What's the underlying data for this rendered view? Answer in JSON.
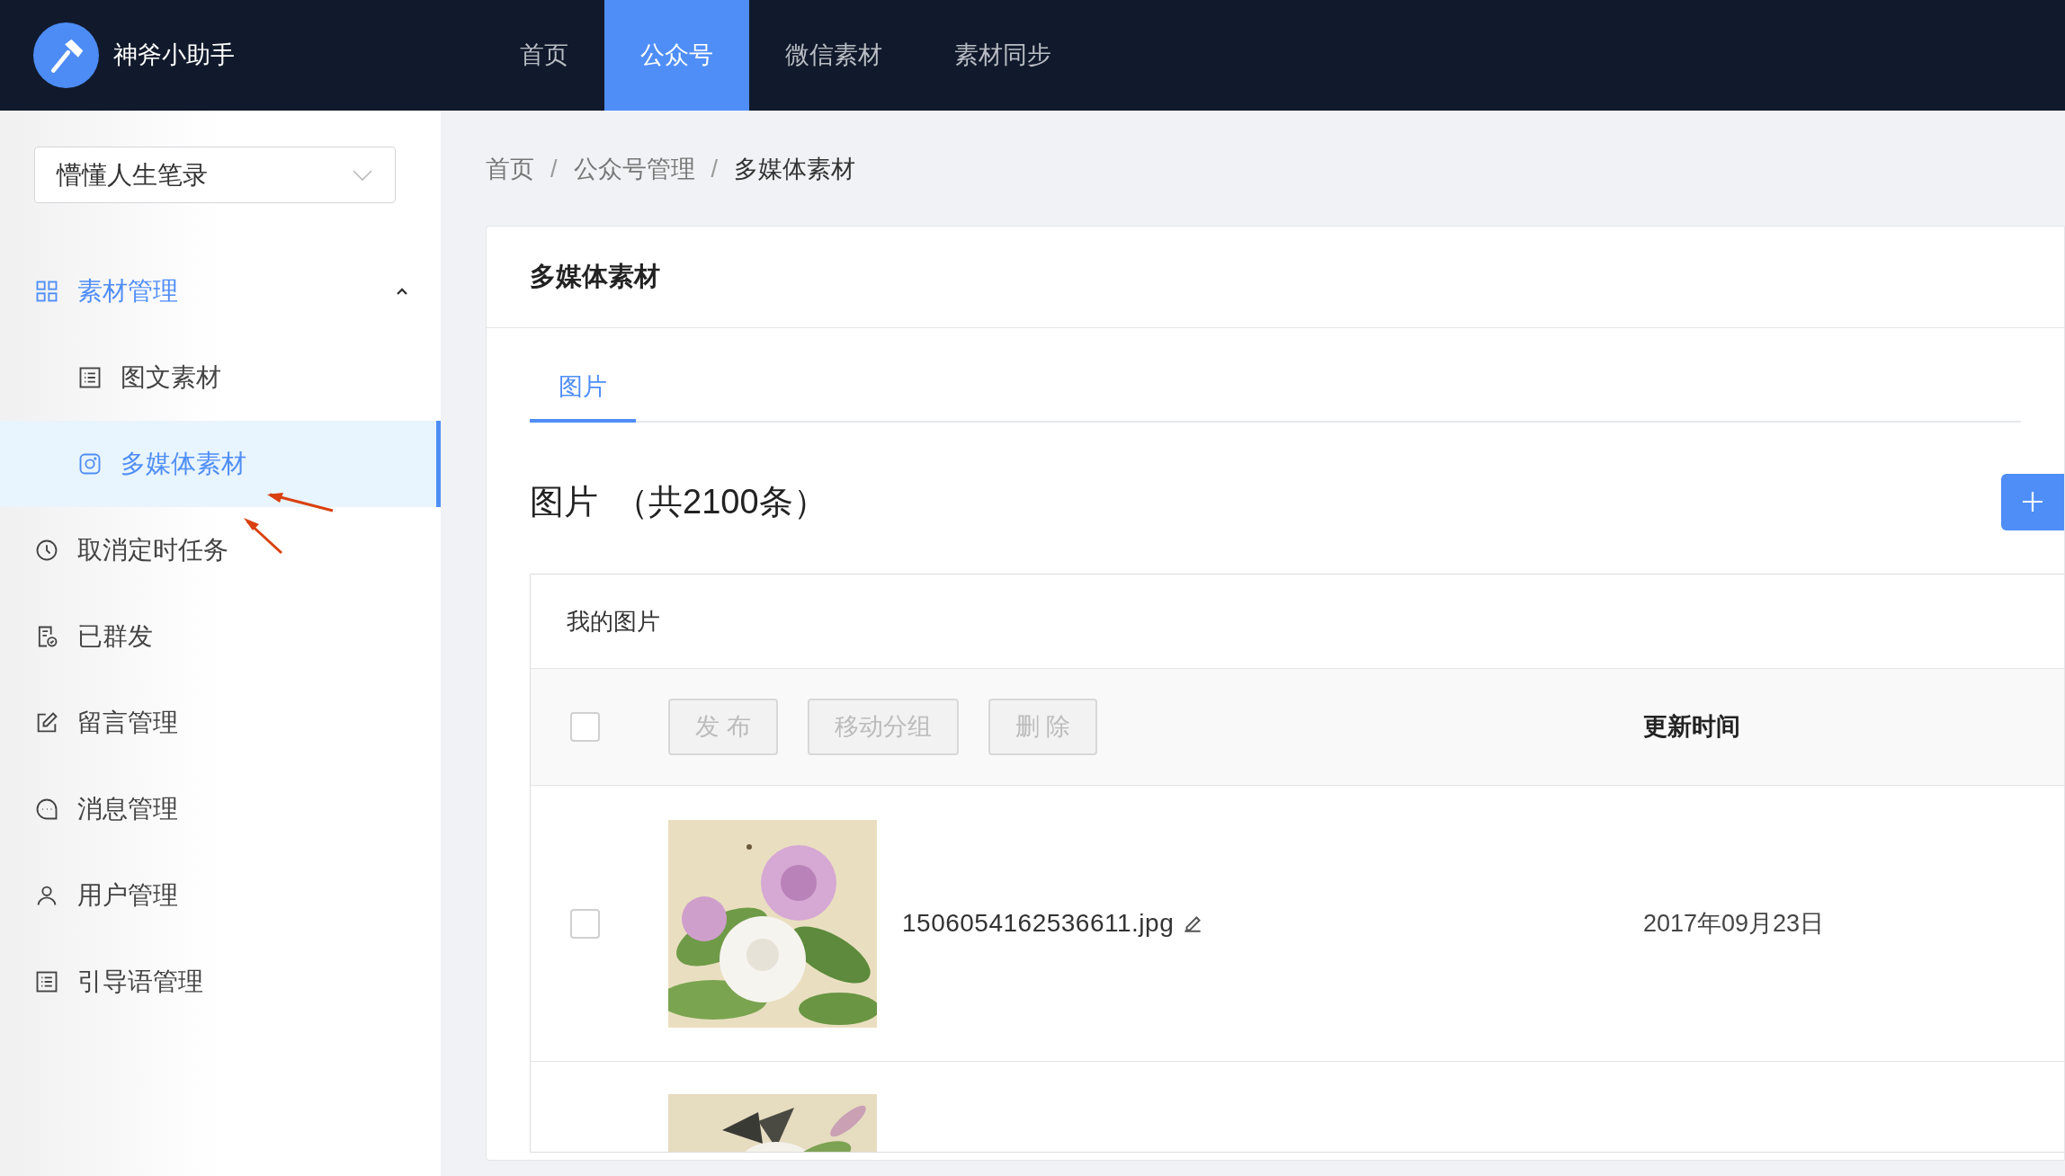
{
  "app": {
    "name": "神斧小助手"
  },
  "top_nav": [
    {
      "label": "首页",
      "selected": false
    },
    {
      "label": "公众号",
      "selected": true
    },
    {
      "label": "微信素材",
      "selected": false
    },
    {
      "label": "素材同步",
      "selected": false
    }
  ],
  "account_select": {
    "value": "懵懂人生笔录"
  },
  "sidebar": {
    "items": [
      {
        "label": "素材管理",
        "kind": "grid",
        "expanded": true,
        "children": [
          {
            "label": "图文素材",
            "kind": "list",
            "selected": false
          },
          {
            "label": "多媒体素材",
            "kind": "camera",
            "selected": true
          }
        ]
      },
      {
        "label": "取消定时任务",
        "kind": "clock",
        "selected": false
      },
      {
        "label": "已群发",
        "kind": "doc-check",
        "selected": false
      },
      {
        "label": "留言管理",
        "kind": "edit",
        "selected": false
      },
      {
        "label": "消息管理",
        "kind": "chat",
        "selected": false
      },
      {
        "label": "用户管理",
        "kind": "user",
        "selected": false
      },
      {
        "label": "引导语管理",
        "kind": "list",
        "selected": false
      }
    ]
  },
  "breadcrumb": [
    {
      "kind": "link",
      "text": "首页"
    },
    {
      "kind": "separator",
      "text": "/"
    },
    {
      "kind": "link",
      "text": "公众号管理"
    },
    {
      "kind": "separator",
      "text": "/"
    },
    {
      "kind": "current",
      "text": "多媒体素材"
    }
  ],
  "card": {
    "title": "多媒体素材",
    "tabs": [
      {
        "label": "图片",
        "selected": true
      }
    ],
    "heading": {
      "title": "图片",
      "count": "（共2100条）"
    },
    "table": {
      "group_title": "我的图片",
      "select_all": {
        "checked": false
      },
      "actions": [
        {
          "label": "发 布",
          "disabled": true
        },
        {
          "label": "移动分组",
          "disabled": true
        },
        {
          "label": "删 除",
          "disabled": true
        }
      ],
      "columns": [
        "更新时间"
      ],
      "rows": [
        {
          "checked": false,
          "kind": "picture",
          "filename": "1506054162536611.jpg",
          "updated": "2017年09月23日"
        },
        {
          "kind": "picture"
        }
      ]
    }
  }
}
